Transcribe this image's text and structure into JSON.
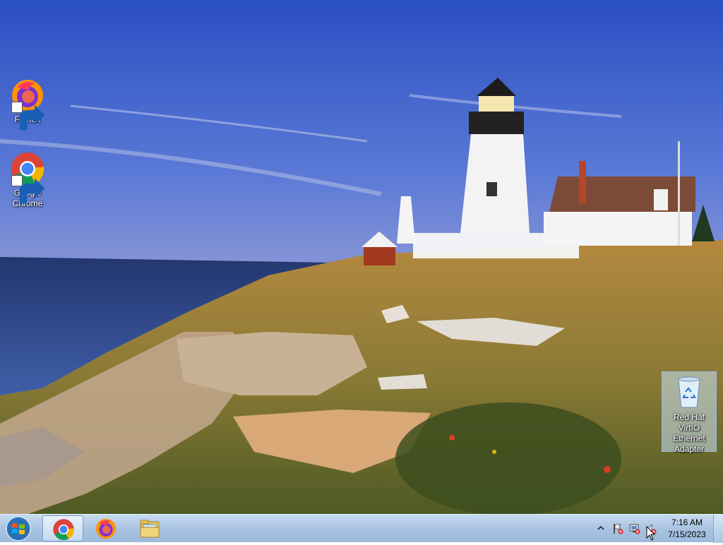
{
  "desktop": {
    "icons": [
      {
        "label": "Firefox",
        "icon": "firefox-icon"
      },
      {
        "label": "Google\nChrome",
        "icon": "chrome-icon"
      }
    ],
    "recycle_bin": {
      "label": "Red Hat\nVirtIO\nEthernet\nAdapter",
      "icon": "recycle-bin-icon"
    }
  },
  "taskbar": {
    "start": {
      "icon": "windows-start-icon"
    },
    "pinned": [
      {
        "icon": "chrome-icon",
        "active": true
      },
      {
        "icon": "firefox-icon",
        "active": false
      },
      {
        "icon": "file-explorer-icon",
        "active": false
      }
    ],
    "tray": {
      "icons": [
        "show-hidden-icons-chevron",
        "action-center-flag-icon",
        "network-disconnected-icon",
        "volume-muted-icon"
      ],
      "time": "7:16 AM",
      "date": "7/15/2023"
    }
  },
  "colors": {
    "taskbar_top": "#c7dbef",
    "taskbar_bottom": "#9cbadc",
    "sky_top": "#2a50c8",
    "sea": "#27407e"
  }
}
